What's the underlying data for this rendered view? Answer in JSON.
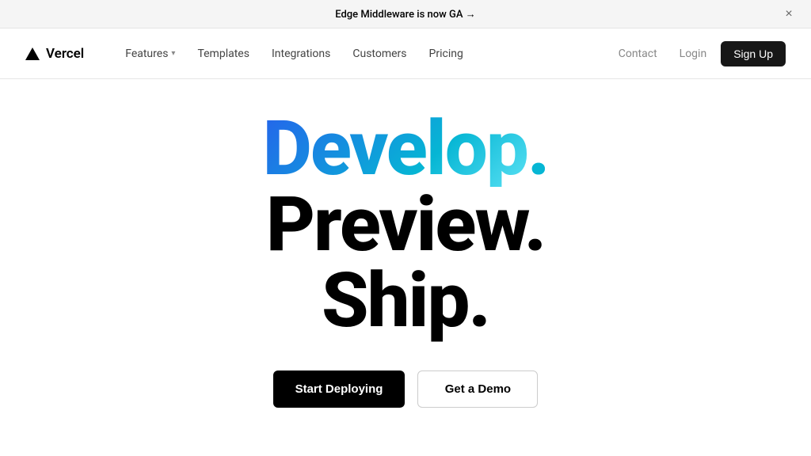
{
  "banner": {
    "text": "Edge Middleware is now GA →",
    "close_label": "×"
  },
  "navbar": {
    "logo_text": "Vercel",
    "nav_items": [
      {
        "label": "Features",
        "has_dropdown": true
      },
      {
        "label": "Templates",
        "has_dropdown": false
      },
      {
        "label": "Integrations",
        "has_dropdown": false
      },
      {
        "label": "Customers",
        "has_dropdown": false
      },
      {
        "label": "Pricing",
        "has_dropdown": false
      }
    ],
    "right_items": [
      {
        "label": "Contact"
      },
      {
        "label": "Login"
      }
    ],
    "signup_label": "Sign Up"
  },
  "hero": {
    "line1": "Develop.",
    "line2": "Preview.",
    "line3": "Ship.",
    "cta_primary": "Start Deploying",
    "cta_secondary": "Get a Demo"
  }
}
